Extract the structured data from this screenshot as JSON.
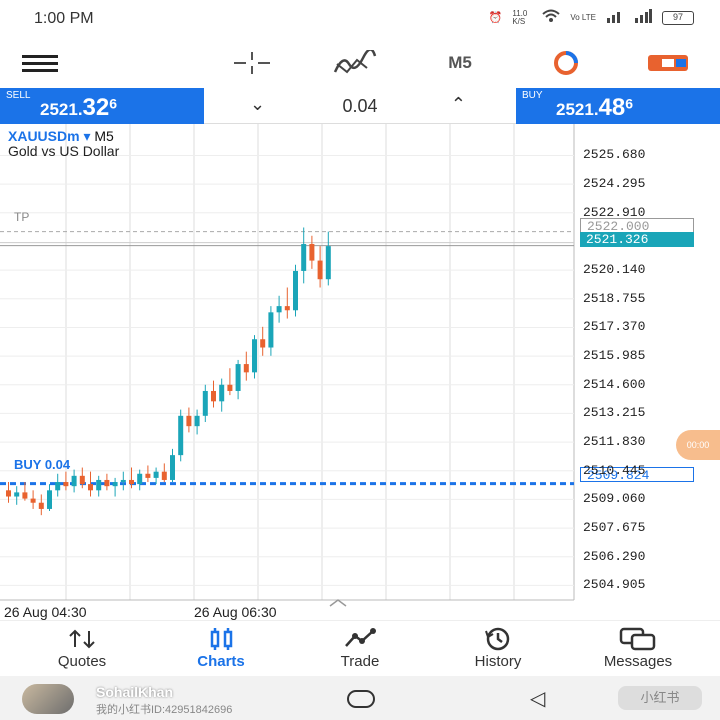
{
  "status": {
    "time": "1:00 PM",
    "network_speed": "11.0 K/S",
    "battery": "97"
  },
  "toolbar": {
    "timeframe": "M5",
    "icons": [
      "hamburger-menu-icon",
      "crosshair-icon",
      "indicators-icon",
      "timeframe-m5",
      "one-click-trading-icon",
      "toggle-icon"
    ]
  },
  "trade": {
    "sell_label": "SELL",
    "sell_price_main": "2521.",
    "sell_price_big": "32",
    "sell_price_sup": "6",
    "buy_label": "BUY",
    "buy_price_main": "2521.",
    "buy_price_big": "48",
    "buy_price_sup": "6",
    "volume": "0.04",
    "decrease_icon": "⌄",
    "increase_icon": "⌃"
  },
  "chart": {
    "symbol": "XAUUSDm",
    "symbol_arrow": "▾",
    "timeframe": "M5",
    "description": "Gold vs US Dollar",
    "tp_label": "TP",
    "buy_label": "BUY 0.04",
    "tp_price_tag": "2522.000",
    "bid_price_tag": "2521.326",
    "entry_price_tag": "2509.824",
    "price_axis": [
      "2525.680",
      "2524.295",
      "2522.910",
      "2520.140",
      "2518.755",
      "2517.370",
      "2515.985",
      "2514.600",
      "2513.215",
      "2511.830",
      "2510.445",
      "2509.060",
      "2507.675",
      "2506.290",
      "2504.905"
    ],
    "time_labels": [
      "26 Aug 04:30",
      "26 Aug 06:30"
    ],
    "colors": {
      "bull": "#1aa5b8",
      "bear": "#e8622f",
      "buy_line": "#1b73e8",
      "grid": "#dcdcdc"
    }
  },
  "chart_data": {
    "type": "candlestick",
    "xlabel": "",
    "ylabel": "",
    "ylim": [
      2504.2,
      2527.2
    ],
    "x": [
      "04:10",
      "04:15",
      "04:20",
      "04:25",
      "04:30",
      "04:35",
      "04:40",
      "04:45",
      "04:50",
      "04:55",
      "05:00",
      "05:05",
      "05:10",
      "05:15",
      "05:20",
      "05:25",
      "05:30",
      "05:35",
      "05:40",
      "05:45",
      "05:50",
      "05:55",
      "06:00",
      "06:05",
      "06:10",
      "06:15",
      "06:20",
      "06:25",
      "06:30",
      "06:35",
      "06:40",
      "06:45",
      "06:50",
      "06:55",
      "07:00",
      "07:05",
      "07:10",
      "07:15",
      "07:20",
      "07:25"
    ],
    "ohlc": [
      [
        2509.5,
        2509.9,
        2508.9,
        2509.2
      ],
      [
        2509.2,
        2509.7,
        2508.8,
        2509.4
      ],
      [
        2509.4,
        2509.9,
        2509.0,
        2509.1
      ],
      [
        2509.1,
        2509.5,
        2508.6,
        2508.9
      ],
      [
        2508.9,
        2509.3,
        2508.3,
        2508.6
      ],
      [
        2508.6,
        2509.8,
        2508.5,
        2509.5
      ],
      [
        2509.5,
        2510.3,
        2509.2,
        2509.9
      ],
      [
        2509.9,
        2510.4,
        2509.5,
        2509.7
      ],
      [
        2509.7,
        2510.5,
        2509.4,
        2510.2
      ],
      [
        2510.2,
        2510.6,
        2509.6,
        2509.8
      ],
      [
        2509.8,
        2510.4,
        2509.2,
        2509.5
      ],
      [
        2509.5,
        2510.2,
        2509.2,
        2510.0
      ],
      [
        2510.0,
        2510.3,
        2509.5,
        2509.7
      ],
      [
        2509.7,
        2510.1,
        2509.2,
        2509.9
      ],
      [
        2509.9,
        2510.4,
        2509.5,
        2510.0
      ],
      [
        2510.0,
        2510.6,
        2509.6,
        2509.8
      ],
      [
        2509.8,
        2510.5,
        2509.5,
        2510.3
      ],
      [
        2510.3,
        2510.7,
        2509.9,
        2510.1
      ],
      [
        2510.1,
        2510.6,
        2509.8,
        2510.4
      ],
      [
        2510.4,
        2510.8,
        2509.9,
        2510.0
      ],
      [
        2510.0,
        2511.5,
        2509.9,
        2511.2
      ],
      [
        2511.2,
        2513.4,
        2510.9,
        2513.1
      ],
      [
        2513.1,
        2513.5,
        2512.3,
        2512.6
      ],
      [
        2512.6,
        2513.4,
        2512.2,
        2513.1
      ],
      [
        2513.1,
        2514.6,
        2512.8,
        2514.3
      ],
      [
        2514.3,
        2514.8,
        2513.5,
        2513.8
      ],
      [
        2513.8,
        2514.9,
        2513.3,
        2514.6
      ],
      [
        2514.6,
        2515.4,
        2514.1,
        2514.3
      ],
      [
        2514.3,
        2515.8,
        2513.9,
        2515.6
      ],
      [
        2515.6,
        2516.2,
        2514.8,
        2515.2
      ],
      [
        2515.2,
        2517.0,
        2514.9,
        2516.8
      ],
      [
        2516.8,
        2517.4,
        2516.0,
        2516.4
      ],
      [
        2516.4,
        2518.4,
        2516.0,
        2518.1
      ],
      [
        2518.1,
        2518.9,
        2517.6,
        2518.4
      ],
      [
        2518.4,
        2519.3,
        2517.8,
        2518.2
      ],
      [
        2518.2,
        2520.4,
        2517.9,
        2520.1
      ],
      [
        2520.1,
        2522.2,
        2519.5,
        2521.4
      ],
      [
        2521.4,
        2521.8,
        2520.2,
        2520.6
      ],
      [
        2520.6,
        2521.3,
        2519.3,
        2519.7
      ],
      [
        2519.7,
        2522.0,
        2519.4,
        2521.3
      ]
    ]
  },
  "nav": [
    {
      "label": "Quotes",
      "icon": "quotes-icon"
    },
    {
      "label": "Charts",
      "icon": "charts-icon"
    },
    {
      "label": "Trade",
      "icon": "trade-icon"
    },
    {
      "label": "History",
      "icon": "history-icon"
    },
    {
      "label": "Messages",
      "icon": "messages-icon"
    }
  ],
  "system": {
    "user_name": "SohailKhan",
    "user_id": "我的小红书ID:42951842696",
    "brand": "小红书"
  }
}
